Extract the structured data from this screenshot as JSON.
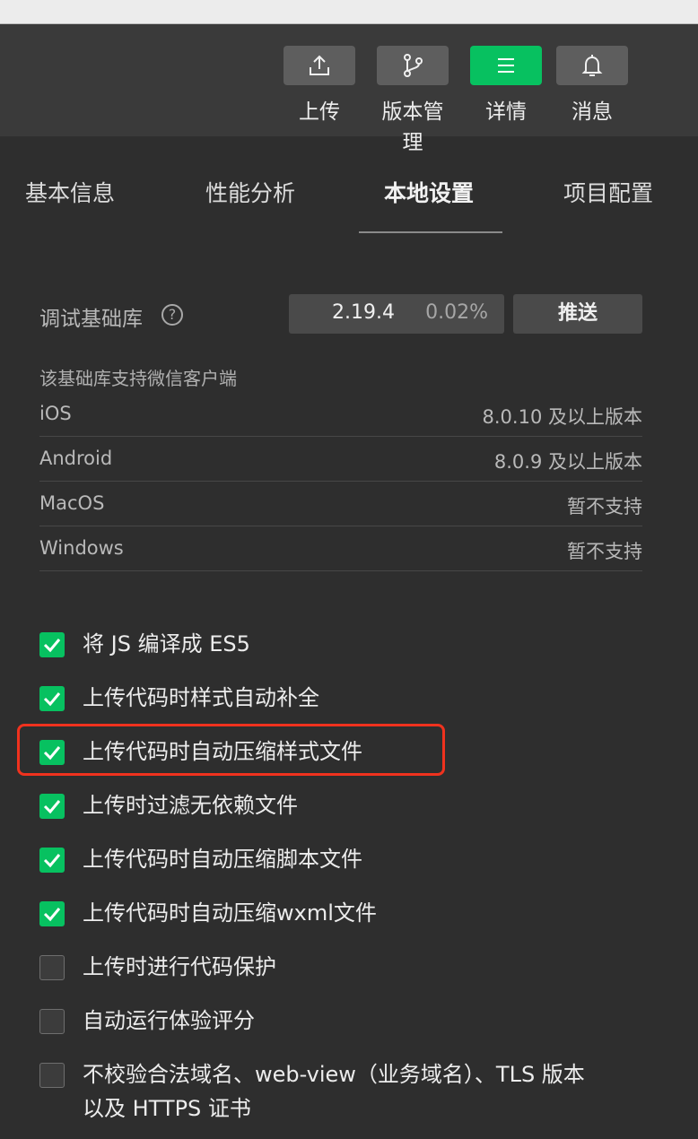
{
  "toolbar": {
    "buttons": [
      {
        "label": "上传",
        "icon": "upload-icon"
      },
      {
        "label": "版本管理",
        "icon": "branch-icon"
      },
      {
        "label": "详情",
        "icon": "menu-icon"
      },
      {
        "label": "消息",
        "icon": "bell-icon"
      }
    ],
    "active_index": 2
  },
  "tabs": [
    "基本信息",
    "性能分析",
    "本地设置",
    "项目配置"
  ],
  "active_tab": "本地设置",
  "debug_lib": {
    "label": "调试基础库",
    "help": "?",
    "version": "2.19.4",
    "percent": "0.02%",
    "push_label": "推送"
  },
  "support": {
    "title": "该基础库支持微信客户端",
    "rows": [
      {
        "name": "iOS",
        "value": "8.0.10 及以上版本"
      },
      {
        "name": "Android",
        "value": "8.0.9 及以上版本"
      },
      {
        "name": "MacOS",
        "value": "暂不支持"
      },
      {
        "name": "Windows",
        "value": "暂不支持"
      }
    ]
  },
  "options": [
    {
      "label": "将 JS 编译成 ES5",
      "checked": true
    },
    {
      "label": "上传代码时样式自动补全",
      "checked": true
    },
    {
      "label": "上传代码时自动压缩样式文件",
      "checked": true
    },
    {
      "label": "上传时过滤无依赖文件",
      "checked": true
    },
    {
      "label": "上传代码时自动压缩脚本文件",
      "checked": true
    },
    {
      "label": "上传代码时自动压缩wxml文件",
      "checked": true
    },
    {
      "label": "上传时进行代码保护",
      "checked": false
    },
    {
      "label": "自动运行体验评分",
      "checked": false
    },
    {
      "label": "不校验合法域名、web-view（业务域名）、TLS 版本以及 HTTPS 证书",
      "checked": false
    }
  ],
  "colors": {
    "accent": "#07c160",
    "highlight": "#f0321e",
    "background": "#2e2e2e"
  }
}
